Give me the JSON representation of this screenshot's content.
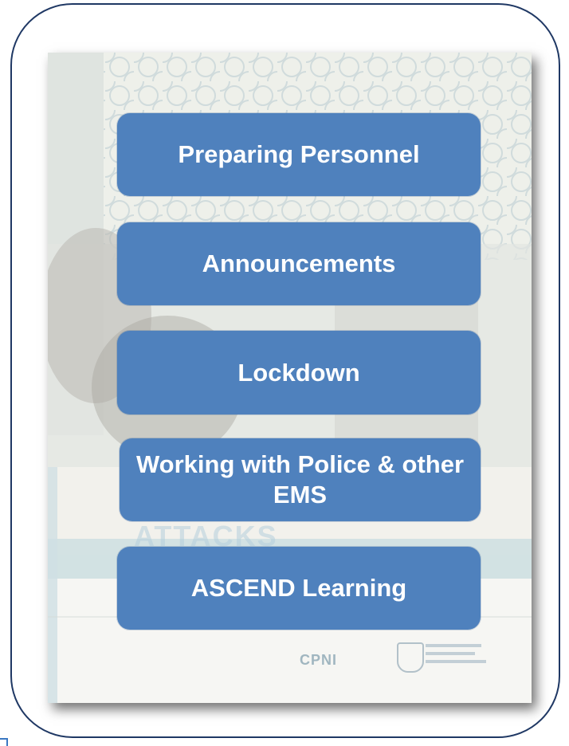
{
  "menu": {
    "items": [
      {
        "label": "Preparing Personnel"
      },
      {
        "label": "Announcements"
      },
      {
        "label": "Lockdown"
      },
      {
        "label": "Working with Police & other EMS"
      },
      {
        "label": "ASCEND Learning"
      }
    ]
  },
  "poster": {
    "background_word": "ATTACKS",
    "logo_left": "CPNI"
  },
  "colors": {
    "button_fill": "#4f81bd",
    "button_text": "#ffffff",
    "frame_border": "#1f3864"
  }
}
